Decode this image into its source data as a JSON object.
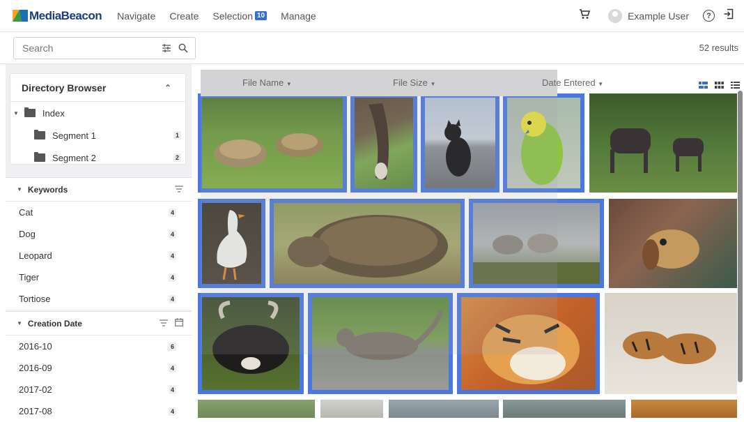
{
  "brand": {
    "name": "MediaBeacon"
  },
  "nav": {
    "items": [
      "Navigate",
      "Create",
      "Selection",
      "Manage"
    ],
    "selection_count": "10"
  },
  "user": {
    "name": "Example User"
  },
  "search": {
    "placeholder": "Search"
  },
  "results_text": "52 results",
  "directory": {
    "title": "Directory Browser",
    "root": "Index",
    "children": [
      {
        "label": "Segment 1",
        "count": "1"
      },
      {
        "label": "Segment 2",
        "count": "2"
      }
    ]
  },
  "keywords": {
    "title": "Keywords",
    "items": [
      {
        "label": "Cat",
        "count": "4"
      },
      {
        "label": "Dog",
        "count": "4"
      },
      {
        "label": "Leopard",
        "count": "4"
      },
      {
        "label": "Tiger",
        "count": "4"
      },
      {
        "label": "Tortiose",
        "count": "4"
      }
    ]
  },
  "creation_date": {
    "title": "Creation Date",
    "items": [
      {
        "label": "2016-10",
        "count": "6"
      },
      {
        "label": "2016-09",
        "count": "4"
      },
      {
        "label": "2017-02",
        "count": "4"
      },
      {
        "label": "2017-08",
        "count": "4"
      }
    ]
  },
  "columns": [
    "File Name",
    "File Size",
    "Date Entered"
  ],
  "colors": {
    "accent": "#4a77e0",
    "badge": "#2f6fd6",
    "brand": "#1a3d7c"
  }
}
